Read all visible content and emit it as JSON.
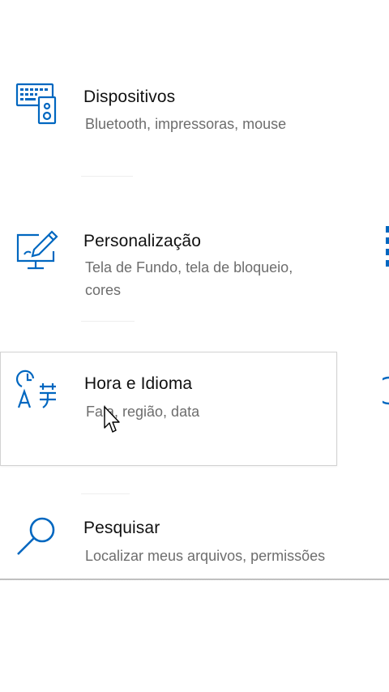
{
  "colors": {
    "accent": "#0067c0",
    "title_text": "#111111",
    "desc_text": "#6d6d6d",
    "hover_border": "#d2d2d2"
  },
  "tiles": [
    {
      "icon": "devices-icon",
      "title": "Dispositivos",
      "desc": "Bluetooth, impressoras, mouse"
    },
    {
      "icon": "personalization-icon",
      "title": "Personalização",
      "desc": "Tela de Fundo, tela de bloqueio, cores"
    },
    {
      "icon": "time-language-icon",
      "title": "Hora e Idioma",
      "desc": "Fala, região, data"
    },
    {
      "icon": "search-icon",
      "title": "Pesquisar",
      "desc": "Localizar meus arquivos, permissões"
    }
  ],
  "right_column": {
    "partial_icons": [
      "apps-icon",
      "gaming-icon"
    ]
  }
}
